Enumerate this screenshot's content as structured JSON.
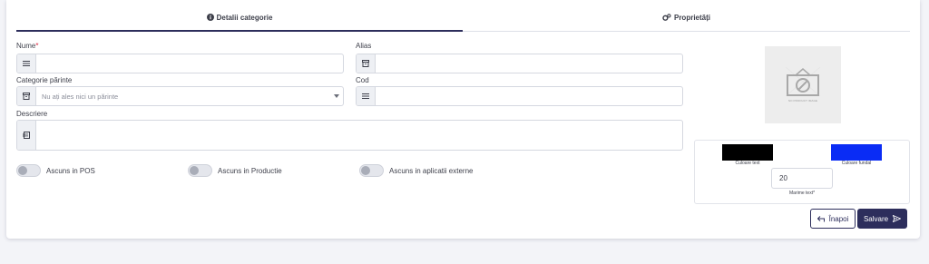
{
  "tabs": [
    {
      "label": "Detalii categorie",
      "icon": "info-circle-icon",
      "active": true
    },
    {
      "label": "Proprietăți",
      "icon": "gears-icon",
      "active": false
    }
  ],
  "form": {
    "name": {
      "label": "Nume",
      "required_mark": "*",
      "value": "",
      "icon": "list-lines-icon"
    },
    "alias": {
      "label": "Alias",
      "value": "",
      "icon": "archive-icon"
    },
    "parent": {
      "label": "Categorie părinte",
      "placeholder": "Nu ați ales nici un părinte",
      "icon": "archive-icon"
    },
    "code": {
      "label": "Cod",
      "value": "",
      "icon": "list-lines-icon"
    },
    "description": {
      "label": "Descriere",
      "value": "",
      "icon": "note-icon"
    }
  },
  "toggles": [
    {
      "label": "Ascuns in POS",
      "on": false
    },
    {
      "label": "Ascuns in Productie",
      "on": false
    },
    {
      "label": "Ascuns in aplicatii externe",
      "on": false
    }
  ],
  "image": {
    "caption": "NO PRODUCT IMAGE"
  },
  "colors": {
    "text": {
      "caption": "Culoare text",
      "value": "#000000"
    },
    "background": {
      "caption": "Culoare fundal",
      "value": "#0a2cf5"
    },
    "size": {
      "caption": "Marime text*",
      "value": "20"
    }
  },
  "buttons": {
    "back": "Înapoi",
    "save": "Salvare"
  },
  "theme": {
    "primary": "#2d2e5c",
    "required": "#d9233c"
  }
}
